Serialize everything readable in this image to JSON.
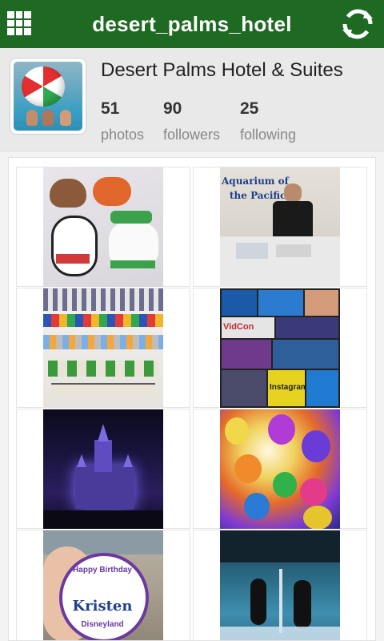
{
  "app": {
    "title": "desert_palms_hotel",
    "colors": {
      "header_green": "#1f6a22",
      "background": "#f3f3f3"
    },
    "icons": {
      "menu": "grid-icon",
      "refresh": "refresh-icon"
    }
  },
  "profile": {
    "name": "Desert Palms Hotel & Suites",
    "stats": [
      {
        "value": "51",
        "label": "photos"
      },
      {
        "value": "90",
        "label": "followers"
      },
      {
        "value": "25",
        "label": "following"
      }
    ]
  },
  "photos": [
    {
      "id": "1",
      "desc": "felt ornaments"
    },
    {
      "id": "2",
      "desc": "aquarium booth",
      "overlay_text": [
        "Aquarium of",
        "the Pacific"
      ]
    },
    {
      "id": "3",
      "desc": "kids crafts banner"
    },
    {
      "id": "4",
      "desc": "event collage",
      "overlay_text": [
        "VidCon",
        "Instagram"
      ]
    },
    {
      "id": "5",
      "desc": "castle at night"
    },
    {
      "id": "6",
      "desc": "colorful balloons"
    },
    {
      "id": "7",
      "desc": "birthday button",
      "overlay_text": [
        "Happy Birthday",
        "Kristen",
        "Disneyland"
      ]
    },
    {
      "id": "8",
      "desc": "orca show"
    }
  ]
}
